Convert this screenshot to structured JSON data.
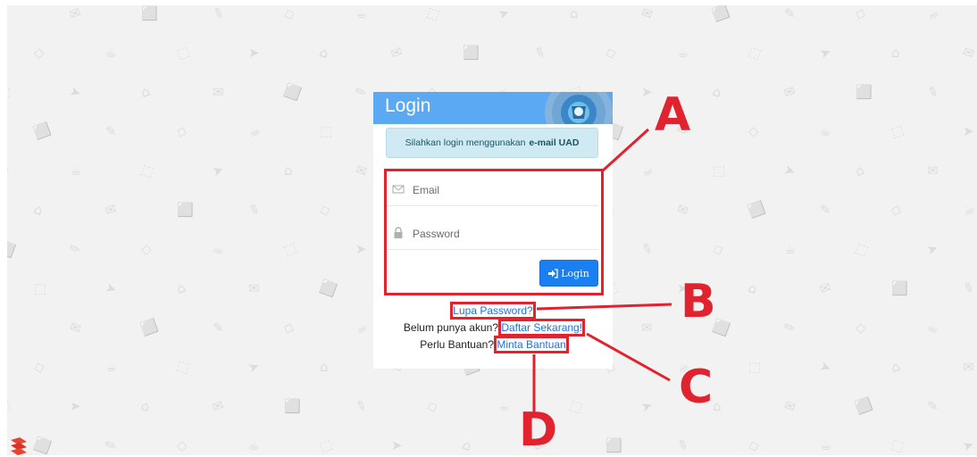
{
  "login": {
    "title": "Login",
    "notice_prefix": "Silahkan login menggunakan",
    "notice_bold": "e-mail UAD",
    "email_placeholder": "Email",
    "password_placeholder": "Password",
    "login_button": "Login"
  },
  "links": {
    "forgot_password": "Lupa Password?",
    "no_account_text": "Belum punya akun?",
    "register": "Daftar Sekarang!",
    "help_text": "Perlu Bantuan?",
    "help_link": "Minta Bantuan"
  },
  "annotations": {
    "a": "A",
    "b": "B",
    "c": "C",
    "d": "D",
    "color": "#e0232e"
  },
  "colors": {
    "header": "#5aa9f2",
    "button": "#1a7ff0",
    "notice_bg": "#cfeaf2",
    "page_bg": "#f2f2f2"
  },
  "icons": {
    "email": "envelope-icon",
    "password": "lock-icon",
    "login": "sign-in-icon",
    "seal": "university-seal-logo"
  }
}
